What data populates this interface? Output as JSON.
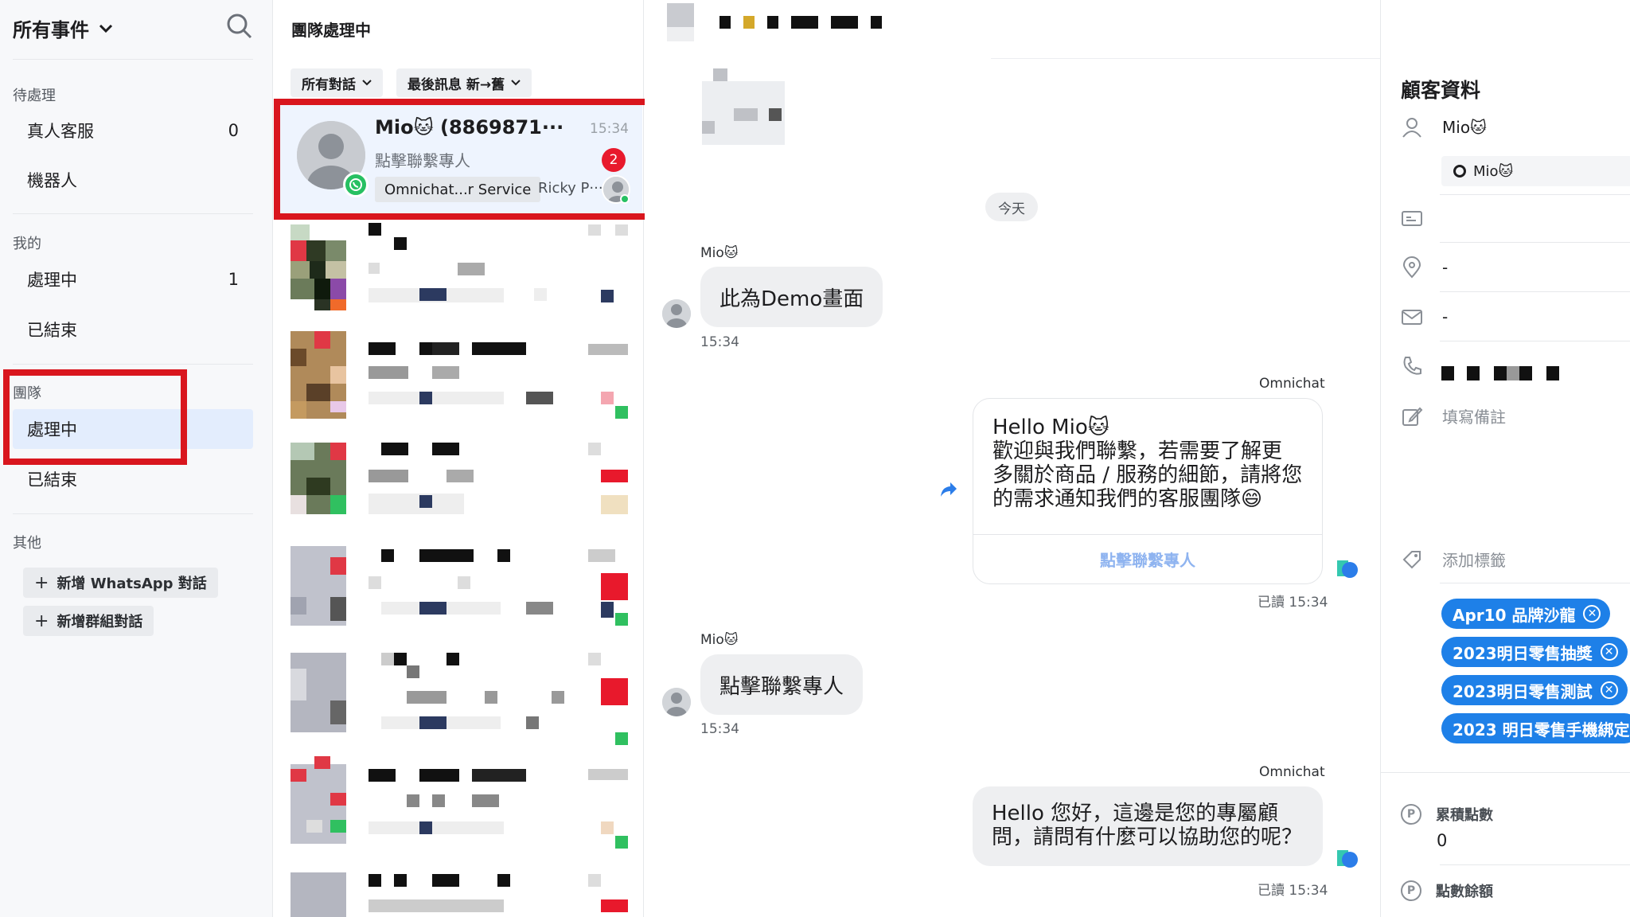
{
  "sidebar": {
    "header": "所有事件",
    "sections": {
      "pending": "待處理",
      "mine": "我的",
      "team": "團隊",
      "other": "其他"
    },
    "pending_items": [
      {
        "label": "真人客服",
        "count": "0"
      },
      {
        "label": "機器人",
        "count": ""
      }
    ],
    "mine_items": [
      {
        "label": "處理中",
        "count": "1"
      },
      {
        "label": "已結束",
        "count": ""
      }
    ],
    "team_items": [
      {
        "label": "處理中",
        "count": ""
      },
      {
        "label": "已結束",
        "count": ""
      }
    ],
    "buttons": {
      "new_whatsapp": "新增 WhatsApp 對話",
      "new_group": "新增群組對話"
    }
  },
  "conv_list": {
    "title": "團隊處理中",
    "filter_all": "所有對話",
    "filter_sort": "最後訊息 新→舊",
    "selected": {
      "name": "Mio🐱 (8869871···",
      "time": "15:34",
      "last_message": "點擊聯繫專人",
      "unread": "2",
      "channel_tag": "Omnichat...r Service",
      "agent": "Ricky P···"
    }
  },
  "chat": {
    "date_chip": "今天",
    "messages": [
      {
        "sender": "Mio🐱",
        "text": "此為Demo畫面",
        "time": "15:34"
      },
      {
        "sender": "Omnichat",
        "lines": [
          "Hello Mio🐱",
          "歡迎與我們聯繫，若需要了解更",
          "多關於商品 / 服務的細節，請將您",
          "的需求通知我們的客服團隊😄"
        ],
        "button": "點擊聯繫專人",
        "read": "已讀 15:34"
      },
      {
        "sender": "Mio🐱",
        "text": "點擊聯繫專人",
        "time": "15:34"
      },
      {
        "sender": "Omnichat",
        "lines": [
          "Hello 您好，這邊是您的專屬顧",
          "問，請問有什麼可以協助您的呢？"
        ],
        "read": "已讀 15:34"
      }
    ]
  },
  "customer": {
    "title": "顧客資料",
    "name": "Mio🐱",
    "whatsapp_name": "Mio🐱",
    "location": "-",
    "email": "-",
    "note_placeholder": "填寫備註",
    "add_tag": "添加標籤",
    "tags": [
      "Apr10 品牌沙龍",
      "2023明日零售抽獎",
      "2023明日零售測試",
      "2023 明日零售手機綁定"
    ],
    "points_label": "累積點數",
    "points_value": "0",
    "balance_label": "點數餘額"
  },
  "colors": {
    "accent": "#1e80e8",
    "highlight_box": "#d9161e",
    "whatsapp_green": "#27c062",
    "unread_red": "#e8192c"
  }
}
